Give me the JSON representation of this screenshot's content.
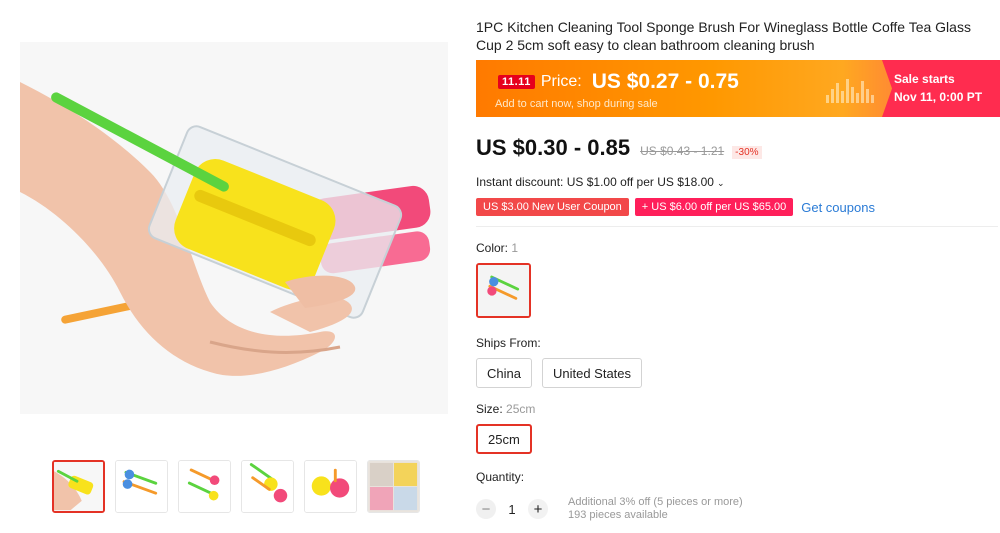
{
  "product": {
    "title": "1PC Kitchen Cleaning Tool Sponge Brush For Wineglass Bottle Coffe Tea Glass Cup 2 5cm soft easy to clean bathroom cleaning brush"
  },
  "gallery": {
    "thumbnails": [
      "thumb-1",
      "thumb-2",
      "thumb-3",
      "thumb-4",
      "thumb-5",
      "thumb-6"
    ],
    "active_index": 0
  },
  "promo": {
    "badge": "11.11",
    "price_label": "Price:",
    "price": "US $0.27 - 0.75",
    "subtext": "Add to cart now, shop during sale",
    "sale_starts_label": "Sale starts",
    "sale_starts_date": "Nov 11, 0:00 PT"
  },
  "pricing": {
    "price": "US $0.30 - 0.85",
    "original_price": "US $0.43 - 1.21",
    "discount": "-30%"
  },
  "instant_discount": {
    "text": "Instant discount: US $1.00 off per US $18.00"
  },
  "coupons": {
    "new_user": "US $3.00 New User Coupon",
    "store": "US $6.00 off per US $65.00",
    "get_coupons": "Get coupons"
  },
  "color": {
    "label": "Color:",
    "selected": "1"
  },
  "ships_from": {
    "label": "Ships From:",
    "options": [
      "China",
      "United States"
    ]
  },
  "size": {
    "label": "Size:",
    "selected": "25cm",
    "options": [
      "25cm"
    ]
  },
  "quantity": {
    "label": "Quantity:",
    "value": "1",
    "minus": "−",
    "plus": "+",
    "note_discount": "Additional 3% off (5 pieces or more)",
    "note_available": "193 pieces available"
  },
  "colors": {
    "accent": "#e43225",
    "promo_orange": "#ff9800",
    "promo_pink": "#ff2c4f",
    "link": "#2a7bd6"
  }
}
